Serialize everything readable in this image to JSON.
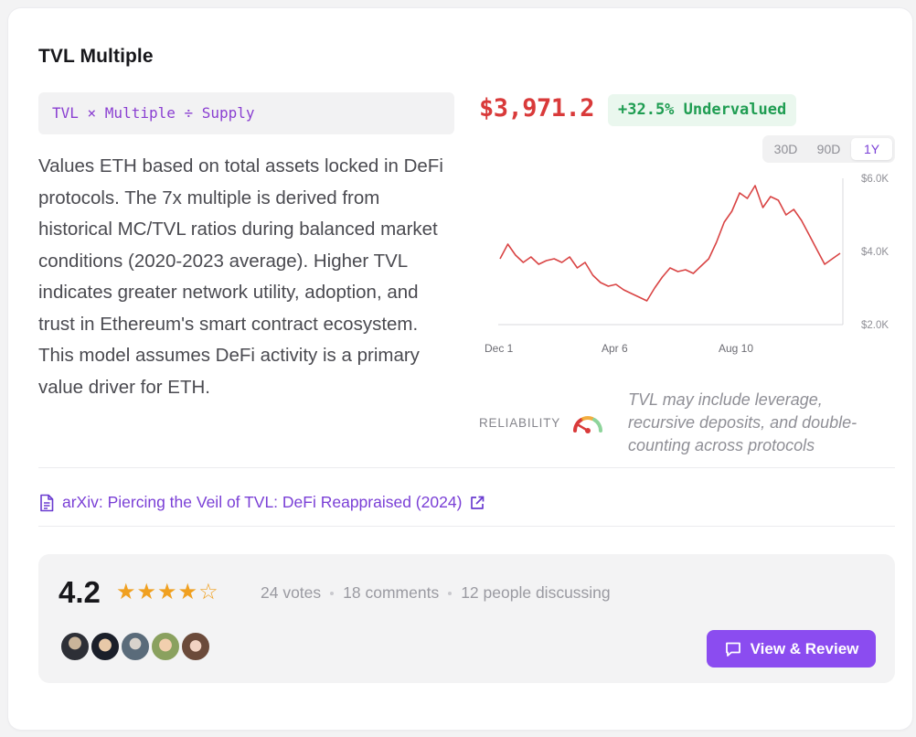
{
  "card": {
    "title": "TVL Multiple",
    "formula": "TVL × Multiple ÷ Supply",
    "description": "Values ETH based on total assets locked in DeFi protocols. The 7x multiple is derived from historical MC/TVL ratios during balanced market conditions (2020-2023 average). Higher TVL indicates greater network utility, adoption, and trust in Ethereum's smart contract ecosystem. This model assumes DeFi activity is a primary value driver for ETH.",
    "price": "$3,971.2",
    "valuation_badge": "+32.5% Undervalued",
    "time_ranges": [
      "30D",
      "90D",
      "1Y"
    ],
    "active_range": "1Y",
    "reliability_label": "RELIABILITY",
    "reliability_caveat": "TVL may include leverage, recursive deposits, and double-counting across protocols",
    "source_link": "arXiv: Piercing the Veil of TVL: DeFi Reappraised (2024)"
  },
  "colors": {
    "accent": "#8b4cf0",
    "price_red": "#d93a3a",
    "positive_green": "#1f9d52",
    "star": "#f0a020",
    "gauge": [
      "#d93a3a",
      "#f0a020",
      "#8ed49b"
    ]
  },
  "icons": {
    "source": "document-icon",
    "external": "external-link-icon",
    "review": "chat-bubble-icon",
    "gauge": "gauge-icon"
  },
  "rating": {
    "score": "4.2",
    "stars_filled": 4,
    "stars_total": 5,
    "votes": "24 votes",
    "comments": "18 comments",
    "discussing": "12 people discussing",
    "review_button": "View & Review"
  },
  "chart_data": {
    "type": "line",
    "x_ticks": [
      "Dec 1",
      "Apr 6",
      "Aug 10"
    ],
    "y_ticks": [
      "$6.0K",
      "$4.0K",
      "$2.0K"
    ],
    "ylim": [
      2000,
      6000
    ],
    "series": [
      {
        "values": [
          3800,
          4200,
          3900,
          3700,
          3850,
          3650,
          3750,
          3800,
          3700,
          3850,
          3550,
          3700,
          3350,
          3150,
          3050,
          3100,
          2950,
          2850,
          2750,
          2650,
          3000,
          3300,
          3550,
          3450,
          3500,
          3400,
          3600,
          3800,
          4250,
          4800,
          5100,
          5600,
          5450,
          5800,
          5200,
          5500,
          5400,
          5000,
          5150,
          4850,
          4450,
          4050,
          3650,
          3800,
          3950
        ]
      }
    ],
    "grid": false
  }
}
